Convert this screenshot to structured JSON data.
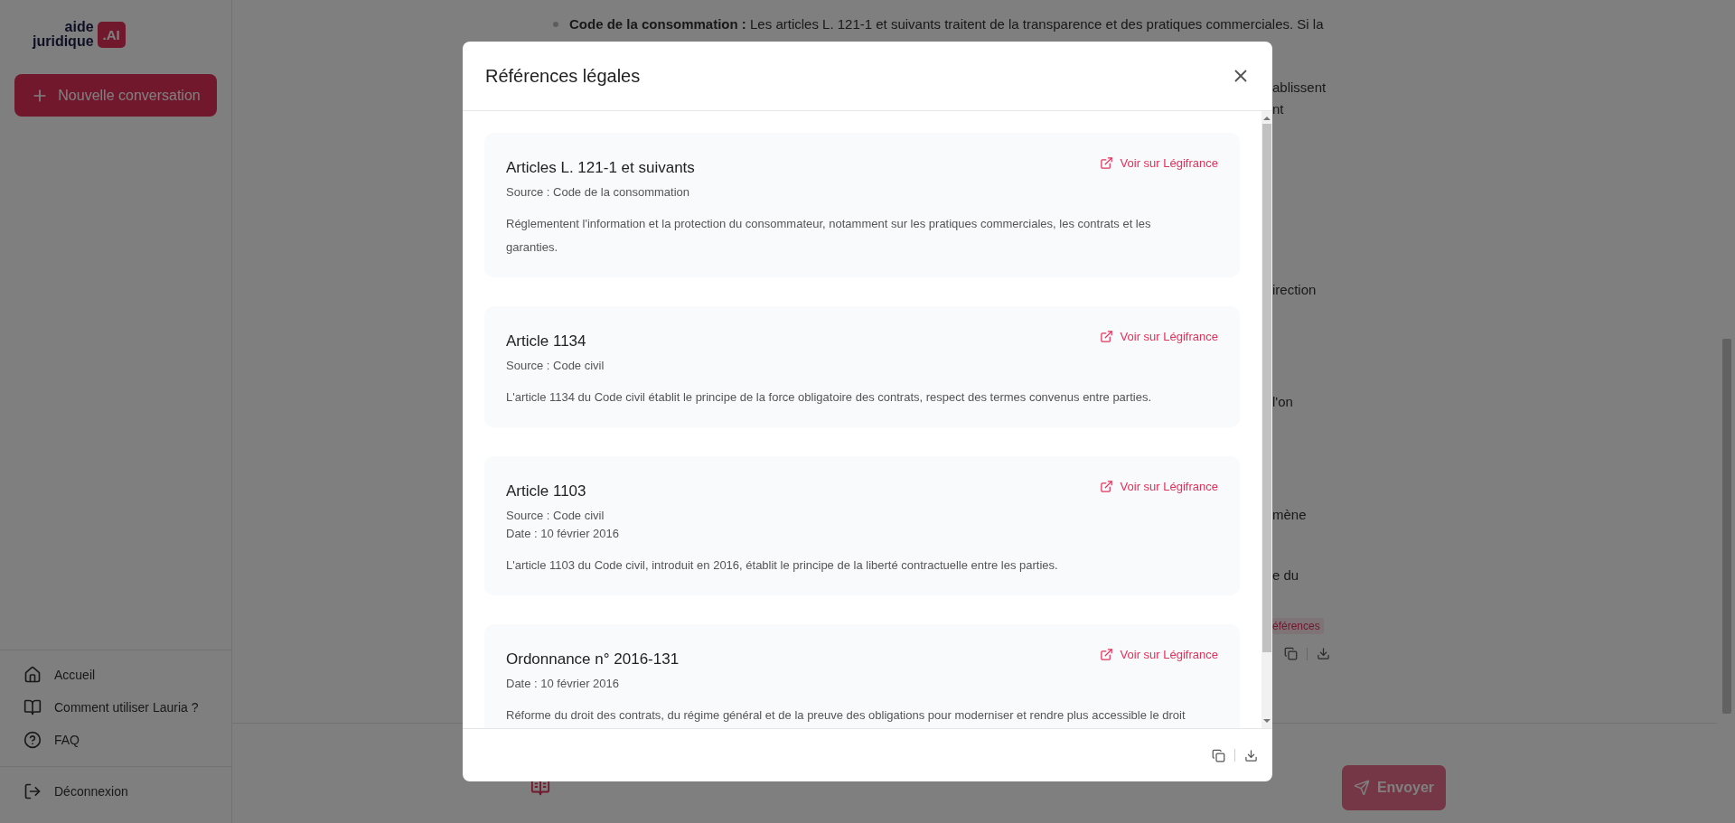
{
  "sidebar": {
    "logo": {
      "line_1": "aide",
      "line_2": "juridique",
      "badge": ".AI"
    },
    "new_button": "Nouvelle conversation",
    "nav_items": [
      {
        "label": "Accueil",
        "kind": "home"
      },
      {
        "label": "Comment utiliser Lauria ?",
        "kind": "book"
      },
      {
        "label": "FAQ",
        "kind": "help"
      }
    ],
    "logout": "Déconnexion"
  },
  "background": {
    "bullet_text": "**Code de la consommation :** Les articles L. 121-1 et suivants traitent de la transparence et des pratiques commerciales. Si la",
    "fragments": [
      "ablissent",
      "nt",
      "irection",
      "l'on",
      "mène",
      "e du"
    ],
    "references_tag": "éférences"
  },
  "composer": {
    "send_button": "Envoyer"
  },
  "modal": {
    "title": "Références légales",
    "references": [
      {
        "title": "Articles L. 121-1 et suivants",
        "source": "Source : Code de la consommation",
        "description": "Réglementent l'information et la protection du consommateur, notamment sur les pratiques commerciales, les contrats et les garanties.",
        "link": "Voir sur Légifrance"
      },
      {
        "title": "Article 1134",
        "source": "Source : Code civil",
        "description": "L'article 1134 du Code civil établit le principe de la force obligatoire des contrats, respect des termes convenus entre parties.",
        "link": "Voir sur Légifrance"
      },
      {
        "title": "Article 1103",
        "source": "Source : Code civil",
        "date": "Date : 10 février 2016",
        "description": "L'article 1103 du Code civil, introduit en 2016, établit le principe de la liberté contractuelle entre les parties.",
        "link": "Voir sur Légifrance"
      },
      {
        "title": "Ordonnance n° 2016-131",
        "date": "Date : 10 février 2016",
        "description": "Réforme du droit des contrats, du régime général et de la preuve des obligations pour moderniser et rendre plus accessible le droit",
        "link": "Voir sur Légifrance"
      }
    ]
  }
}
